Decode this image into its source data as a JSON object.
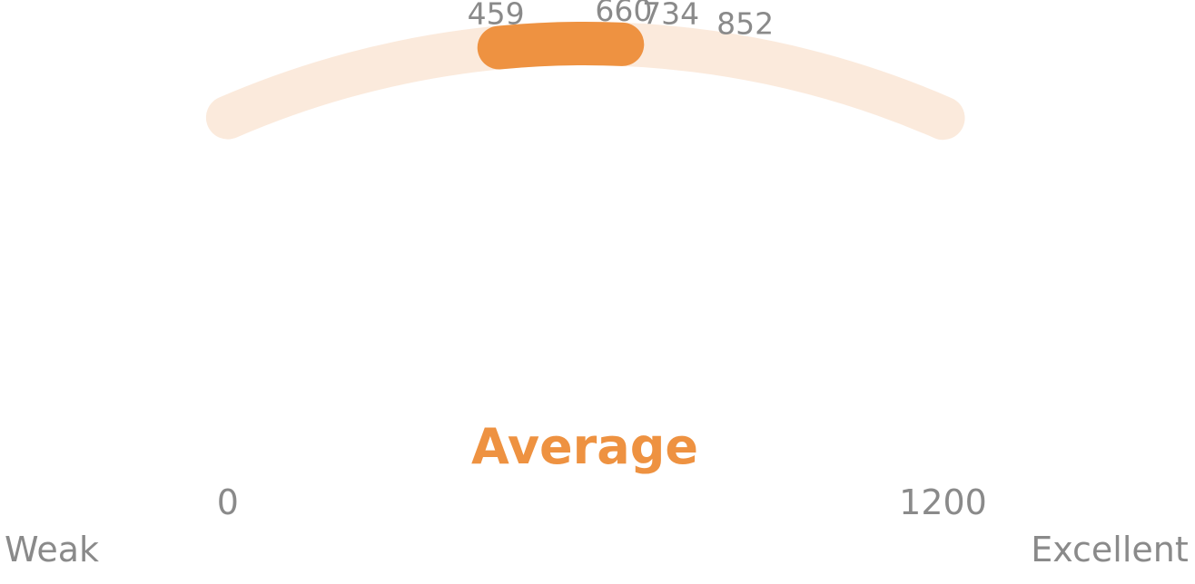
{
  "chart_data": {
    "type": "gauge",
    "min": 0,
    "max": 1200,
    "range_start": 459,
    "range_end": 660,
    "tick_values": [
      459,
      660,
      734,
      852
    ],
    "min_value_label": "0",
    "max_value_label": "1200",
    "min_caption": "Weak",
    "max_caption": "Excellent",
    "center_label": "Average",
    "colors": {
      "track": "#fbeadc",
      "value": "#ee9241",
      "labels": "#8a8a8a",
      "center_label": "#ee9241"
    }
  }
}
